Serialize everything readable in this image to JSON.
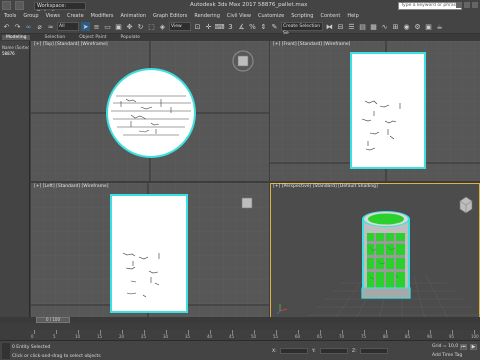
{
  "window": {
    "workspace": "Workspace: Default",
    "title": "Autodesk 3ds Max 2017     58876_pallet.max",
    "search_placeholder": "Type a keyword or phrase"
  },
  "menu": [
    "Tools",
    "Group",
    "Views",
    "Create",
    "Modifiers",
    "Animation",
    "Graph Editors",
    "Rendering",
    "Civil View",
    "Customize",
    "Scripting",
    "Content",
    "Help"
  ],
  "toolbar": {
    "undo_icon": "undo-icon",
    "filter": "All",
    "view": "View",
    "selection_set": "Create Selection Se"
  },
  "ribbon": {
    "tabs": [
      "Modeling",
      "Selection",
      "Object Paint",
      "Populate"
    ]
  },
  "left_panel": {
    "rows": [
      "Name (Sorted Asc)",
      "58876"
    ]
  },
  "viewports": {
    "top": "[+] [Top] [Standard] [Wireframe]",
    "front": "[+] [Front] [Standard] [Wireframe]",
    "left": "[+] [Left] [Standard] [Wireframe]",
    "perspective": "[+] [Perspective] [Standard] [Default Shading]"
  },
  "timeline": {
    "frame": "0 / 100",
    "ticks": [
      "0",
      "5",
      "10",
      "15",
      "20",
      "25",
      "30",
      "35",
      "40",
      "45",
      "50",
      "55",
      "60",
      "65",
      "70",
      "75",
      "80",
      "85",
      "90",
      "95",
      "100"
    ]
  },
  "status": {
    "selected": "0 Entity Selected",
    "prompt": "Click or click-and-drag to select objects",
    "x_label": "X:",
    "y_label": "Y:",
    "z_label": "Z:",
    "grid": "Grid = 10,0",
    "add_time_tag": "Add Time Tag"
  },
  "colors": {
    "accent": "#2b5c86",
    "active_viewport": "#e0b340",
    "selection_cyan": "#3de0e0",
    "object_green": "#2cd02c"
  }
}
